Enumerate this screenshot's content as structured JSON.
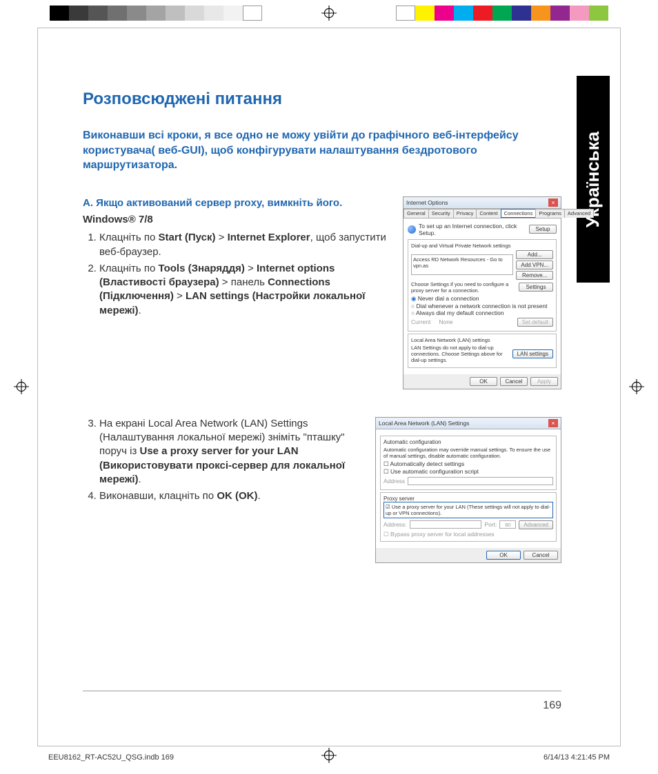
{
  "print": {
    "grays": [
      "#000000",
      "#3a3a3a",
      "#555555",
      "#707070",
      "#8a8a8a",
      "#a4a4a4",
      "#bfbfbf",
      "#d9d9d9",
      "#e8e8e8",
      "#f2f2f2"
    ],
    "colors": [
      "#fff200",
      "#ec008c",
      "#00aeef",
      "#ed1c24",
      "#00a651",
      "#2e3192",
      "#f7941e",
      "#92278f",
      "#f49ac1",
      "#8dc63f"
    ]
  },
  "lang_tab": "Українська",
  "title": "Розповсюджені питання",
  "intro": "Виконавши всі кроки, я все одно не можу увійти до графічного веб-інтерфейсу користувача( веб-GUI), щоб конфігурувати налаштування бездротового маршрутизатора.",
  "section_a": "A.   Якщо активований сервер proxy, вимкніть його.",
  "os_heading": "Windows® 7/8",
  "steps_a": [
    {
      "pre": "Клацніть по ",
      "bold": "Start (Пуск)",
      "mid": " > ",
      "bold2": "Internet Explorer",
      "post": ", щоб запустити веб-браузер."
    },
    {
      "pre": "Клацніть по ",
      "bold": "Tools (Знаряддя)",
      "mid": " > ",
      "bold2": "Internet options (Властивості браузера)",
      "mid2": " > панель ",
      "bold3": "Connections (Підключення)",
      "mid3": " > ",
      "bold4": "LAN settings (Настройки локальної мережі)",
      "post": "."
    }
  ],
  "steps_b": [
    {
      "pre": "На екрані Local Area Network (LAN) Settings (Налаштування локальної мережі) зніміть \"пташку\" поруч із ",
      "bold": "Use a proxy server for your LAN (Використовувати проксі-сервер для локальної мережі)",
      "post": "."
    },
    {
      "pre": "Виконавши, клацніть по ",
      "bold": "OK (OK)",
      "post": "."
    }
  ],
  "dlg1": {
    "title": "Internet Options",
    "tabs": [
      "General",
      "Security",
      "Privacy",
      "Content",
      "Connections",
      "Programs",
      "Advanced"
    ],
    "active_tab": "Connections",
    "setup_text": "To set up an Internet connection, click Setup.",
    "setup_btn": "Setup",
    "dialup_label": "Dial-up and Virtual Private Network settings",
    "dialup_item": "Access RD Network Resources - Go to vpn.as",
    "btn_add": "Add...",
    "btn_addvpn": "Add VPN...",
    "btn_remove": "Remove...",
    "choose_text": "Choose Settings if you need to configure a proxy server for a connection.",
    "btn_settings": "Settings",
    "radio1": "Never dial a connection",
    "radio2": "Dial whenever a network connection is not present",
    "radio3": "Always dial my default connection",
    "current": "Current",
    "none": "None",
    "btn_setdefault": "Set default",
    "lan_label": "Local Area Network (LAN) settings",
    "lan_text": "LAN Settings do not apply to dial-up connections. Choose Settings above for dial-up settings.",
    "btn_lan": "LAN settings",
    "btn_ok": "OK",
    "btn_cancel": "Cancel",
    "btn_apply": "Apply"
  },
  "dlg2": {
    "title": "Local Area Network (LAN) Settings",
    "auto_label": "Automatic configuration",
    "auto_text": "Automatic configuration may override manual settings. To ensure the use of manual settings, disable automatic configuration.",
    "chk_auto": "Automatically detect settings",
    "chk_script": "Use automatic configuration script",
    "addr_label": "Address",
    "proxy_label": "Proxy server",
    "chk_proxy": "Use a proxy server for your LAN (These settings will not apply to dial-up or VPN connections).",
    "addr2_label": "Address:",
    "port_label": "Port:",
    "port_value": "80",
    "btn_adv": "Advanced",
    "chk_bypass": "Bypass proxy server for local addresses",
    "btn_ok": "OK",
    "btn_cancel": "Cancel"
  },
  "page_number": "169",
  "slug_left": "EEU8162_RT-AC52U_QSG.indb   169",
  "slug_right": "6/14/13   4:21:45 PM"
}
